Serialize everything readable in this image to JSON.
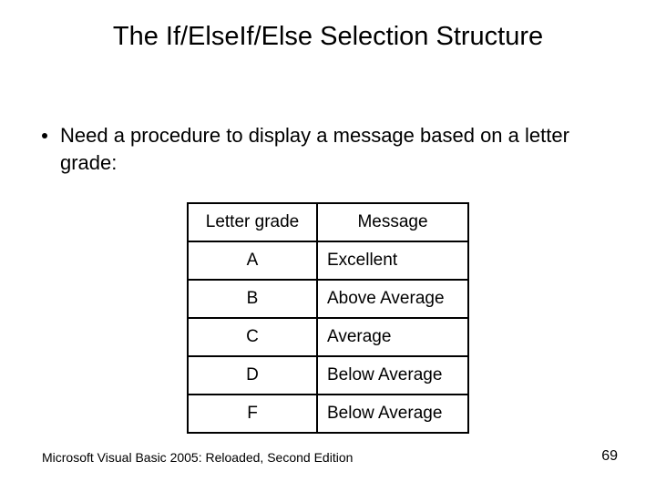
{
  "title": "The If/ElseIf/Else Selection Structure",
  "bullet": "Need a procedure to display a message based on a letter grade:",
  "table": {
    "headers": [
      "Letter grade",
      "Message"
    ],
    "rows": [
      {
        "grade": "A",
        "message": "Excellent"
      },
      {
        "grade": "B",
        "message": "Above Average"
      },
      {
        "grade": "C",
        "message": "Average"
      },
      {
        "grade": "D",
        "message": "Below Average"
      },
      {
        "grade": "F",
        "message": "Below Average"
      }
    ]
  },
  "footer_left": "Microsoft Visual Basic 2005: Reloaded, Second Edition",
  "footer_right": "69"
}
